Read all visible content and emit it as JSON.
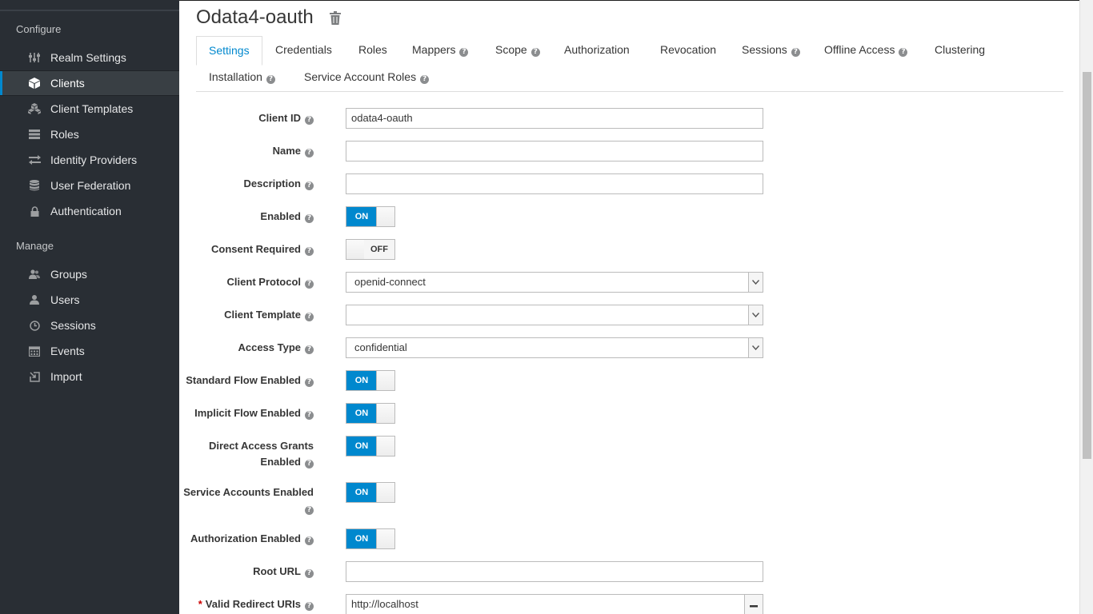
{
  "sidebar": {
    "configure_label": "Configure",
    "manage_label": "Manage",
    "configure_items": [
      {
        "label": "Realm Settings",
        "icon": "sliders-icon"
      },
      {
        "label": "Clients",
        "icon": "cube-icon"
      },
      {
        "label": "Client Templates",
        "icon": "cubes-icon"
      },
      {
        "label": "Roles",
        "icon": "list-icon"
      },
      {
        "label": "Identity Providers",
        "icon": "exchange-icon"
      },
      {
        "label": "User Federation",
        "icon": "database-icon"
      },
      {
        "label": "Authentication",
        "icon": "lock-icon"
      }
    ],
    "manage_items": [
      {
        "label": "Groups",
        "icon": "users-icon"
      },
      {
        "label": "Users",
        "icon": "user-icon"
      },
      {
        "label": "Sessions",
        "icon": "clock-icon"
      },
      {
        "label": "Events",
        "icon": "calendar-icon"
      },
      {
        "label": "Import",
        "icon": "import-icon"
      }
    ],
    "active_item": "Clients"
  },
  "header": {
    "title": "Odata4-oauth"
  },
  "tabs": [
    {
      "label": "Settings"
    },
    {
      "label": "Credentials"
    },
    {
      "label": "Roles"
    },
    {
      "label": "Mappers"
    },
    {
      "label": "Scope"
    },
    {
      "label": "Authorization"
    },
    {
      "label": "Revocation"
    },
    {
      "label": "Sessions"
    },
    {
      "label": "Offline Access"
    },
    {
      "label": "Clustering"
    },
    {
      "label": "Installation"
    },
    {
      "label": "Service Account Roles"
    }
  ],
  "form": {
    "client_id": {
      "label": "Client ID",
      "value": "odata4-oauth"
    },
    "name": {
      "label": "Name",
      "value": ""
    },
    "description": {
      "label": "Description",
      "value": ""
    },
    "enabled": {
      "label": "Enabled",
      "state": "ON"
    },
    "consent_required": {
      "label": "Consent Required",
      "state": "OFF"
    },
    "client_protocol": {
      "label": "Client Protocol",
      "value": "openid-connect"
    },
    "client_template": {
      "label": "Client Template",
      "value": ""
    },
    "access_type": {
      "label": "Access Type",
      "value": "confidential"
    },
    "standard_flow": {
      "label": "Standard Flow Enabled",
      "state": "ON"
    },
    "implicit_flow": {
      "label": "Implicit Flow Enabled",
      "state": "ON"
    },
    "direct_access_line1": "Direct Access Grants",
    "direct_access_line2": "Enabled",
    "direct_access_state": "ON",
    "service_accounts": {
      "label": "Service Accounts Enabled",
      "state": "ON"
    },
    "authorization_enabled": {
      "label": "Authorization Enabled",
      "state": "ON"
    },
    "root_url": {
      "label": "Root URL",
      "value": ""
    },
    "redirect_uris": {
      "required_mark": "*",
      "label": "Valid Redirect URIs",
      "value": "http://localhost"
    }
  },
  "colors": {
    "sidebar_bg": "#292e34",
    "accent": "#0088ce",
    "required": "#cc0000"
  }
}
